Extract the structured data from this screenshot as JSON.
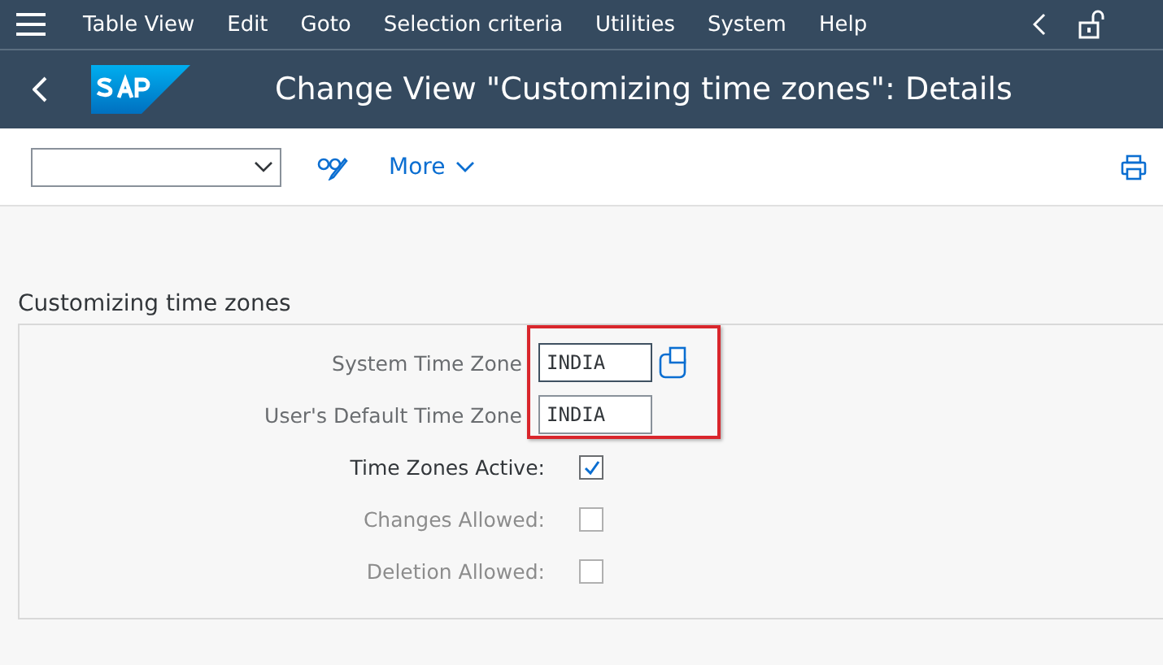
{
  "menu_bar": {
    "items": [
      "Table View",
      "Edit",
      "Goto",
      "Selection criteria",
      "Utilities",
      "System",
      "Help"
    ]
  },
  "title_bar": {
    "title": "Change View \"Customizing time zones\": Details"
  },
  "toolbar": {
    "more": "More"
  },
  "group": {
    "title": "Customizing time zones",
    "fields": [
      {
        "kind": "input",
        "label": "System Time Zone",
        "value": "INDIA",
        "focused": true
      },
      {
        "kind": "input",
        "label": "User's Default Time Zone",
        "value": "INDIA",
        "focused": false
      },
      {
        "kind": "checkbox",
        "label": "Time Zones Active:",
        "checked": true,
        "disabled": false
      },
      {
        "kind": "checkbox",
        "label": "Changes Allowed:",
        "checked": false,
        "disabled": true
      },
      {
        "kind": "checkbox",
        "label": "Deletion Allowed:",
        "checked": false,
        "disabled": true
      }
    ]
  }
}
